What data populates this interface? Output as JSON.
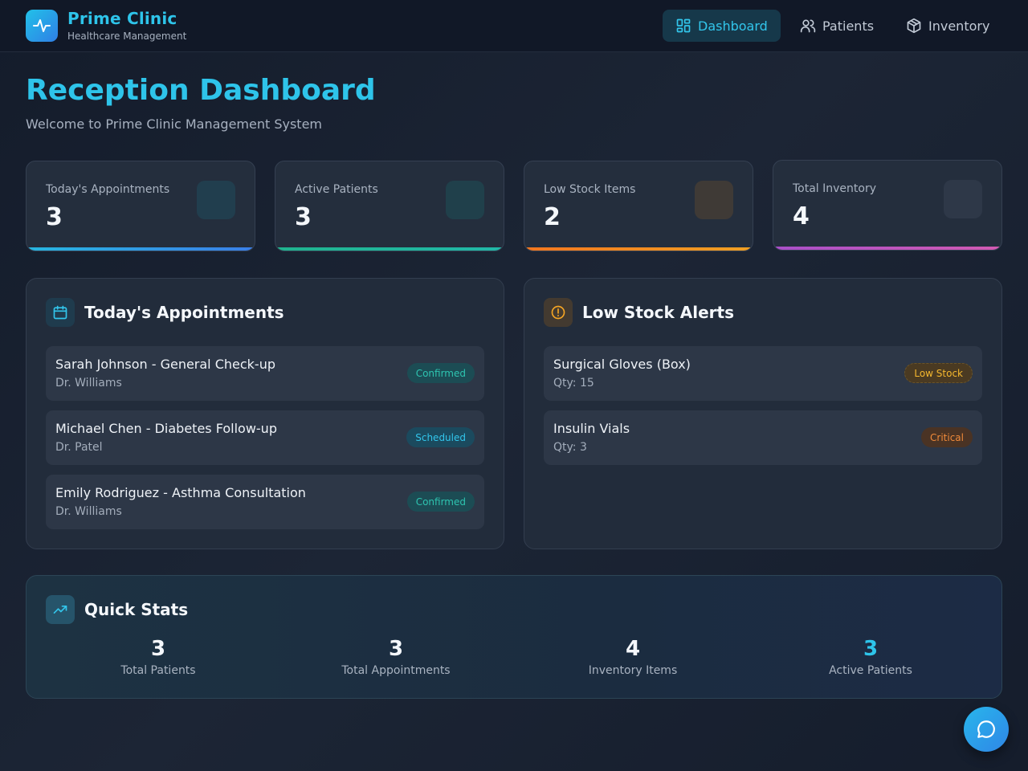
{
  "header": {
    "brand": "Prime Clinic",
    "subtitle": "Healthcare Management",
    "nav": [
      {
        "label": "Dashboard",
        "icon": "grid-icon",
        "active": true
      },
      {
        "label": "Patients",
        "icon": "users-icon",
        "active": false
      },
      {
        "label": "Inventory",
        "icon": "box-icon",
        "active": false
      }
    ]
  },
  "page": {
    "title": "Reception Dashboard",
    "subtitle": "Welcome to Prime Clinic Management System"
  },
  "stats": [
    {
      "label": "Today's Appointments",
      "value": "3",
      "color": "#2f8ee6"
    },
    {
      "label": "Active Patients",
      "value": "3",
      "color": "#22b39a"
    },
    {
      "label": "Low Stock Items",
      "value": "2",
      "color": "#f08a24"
    },
    {
      "label": "Total Inventory",
      "value": "4",
      "color": "#b04fc8"
    }
  ],
  "appointments": {
    "title": "Today's Appointments",
    "icon": "calendar-icon",
    "items": [
      {
        "title": "Sarah Johnson - General Check-up",
        "doctor": "Dr. Williams",
        "status": "Confirmed"
      },
      {
        "title": "Michael Chen - Diabetes Follow-up",
        "doctor": "Dr. Patel",
        "status": "Scheduled"
      },
      {
        "title": "Emily Rodriguez - Asthma Consultation",
        "doctor": "Dr. Williams",
        "status": "Confirmed"
      }
    ]
  },
  "low_stock": {
    "title": "Low Stock Alerts",
    "icon": "alert-circle-icon",
    "items": [
      {
        "name": "Surgical Gloves (Box)",
        "qty": "Qty: 15",
        "status": "Low Stock"
      },
      {
        "name": "Insulin Vials",
        "qty": "Qty: 3",
        "status": "Critical"
      }
    ]
  },
  "quick_stats": {
    "title": "Quick Stats",
    "icon": "trending-up-icon",
    "items": [
      {
        "value": "3",
        "label": "Total Patients"
      },
      {
        "value": "3",
        "label": "Total Appointments"
      },
      {
        "value": "4",
        "label": "Inventory Items"
      },
      {
        "value": "3",
        "label": "Active Patients"
      }
    ]
  },
  "fab": {
    "icon": "chat-icon"
  }
}
